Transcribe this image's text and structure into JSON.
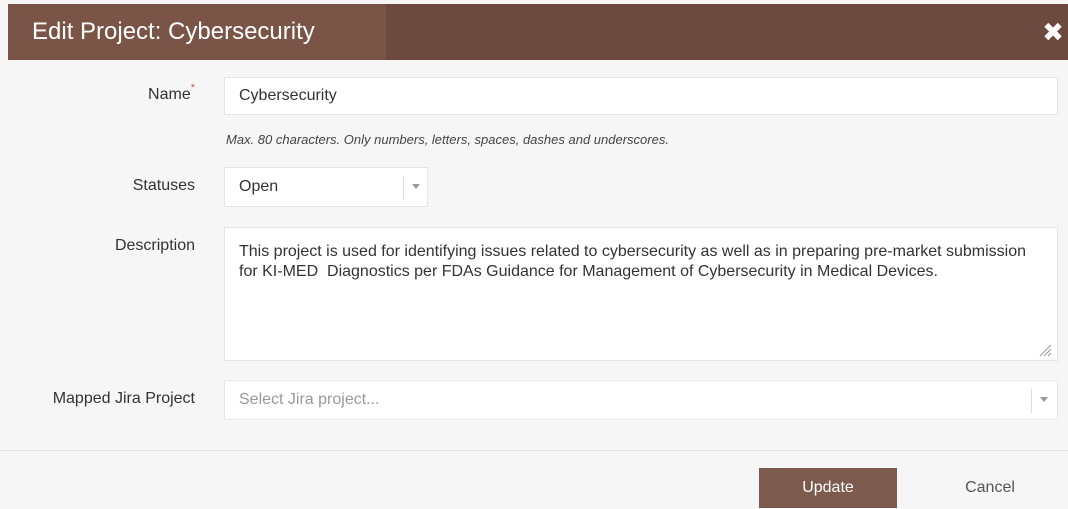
{
  "dialog": {
    "title": "Edit Project: Cybersecurity",
    "close_icon": "close-icon"
  },
  "form": {
    "name": {
      "label": "Name",
      "required_marker": "*",
      "value": "Cybersecurity",
      "hint": "Max. 80 characters. Only numbers, letters, spaces, dashes and underscores."
    },
    "statuses": {
      "label": "Statuses",
      "selected": "Open"
    },
    "description": {
      "label": "Description",
      "value": "This project is used for identifying issues related to cybersecurity as well as in preparing pre-market submission for KI-MED  Diagnostics per FDAs Guidance for Management of Cybersecurity in Medical Devices."
    },
    "jira": {
      "label": "Mapped Jira Project",
      "placeholder": "Select Jira project..."
    }
  },
  "footer": {
    "update_label": "Update",
    "cancel_label": "Cancel"
  },
  "colors": {
    "header": "#6d4a3f",
    "header_title_bg": "#7a5447",
    "update_button": "#7c5a4d",
    "required_marker": "#d9534f"
  }
}
